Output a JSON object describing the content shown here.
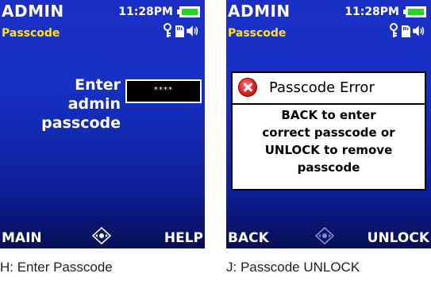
{
  "screens": [
    {
      "title": "ADMIN",
      "subtitle": "Passcode",
      "clock": "11:28PM",
      "prompt": "Enter admin passcode",
      "passcode_value": "****",
      "softkey_left": "MAIN",
      "softkey_right": "HELP",
      "caption": "H: Enter Passcode"
    },
    {
      "title": "ADMIN",
      "subtitle": "Passcode",
      "clock": "11:28PM",
      "dialog_title": "Passcode Error",
      "dialog_lines": [
        "BACK to enter",
        "correct passcode or",
        "UNLOCK to remove",
        "passcode"
      ],
      "softkey_left": "BACK",
      "softkey_right": "UNLOCK",
      "caption": "J: Passcode UNLOCK"
    }
  ],
  "icons": [
    "battery-icon",
    "key-icon",
    "sd-card-icon",
    "speaker-icon",
    "navigation-pad-icon",
    "error-icon"
  ],
  "colors": {
    "screen_blue": "#1531c4",
    "subtitle_yellow": "#ffe21a",
    "battery_green": "#21d61f",
    "error_red": "#e01e1e"
  }
}
